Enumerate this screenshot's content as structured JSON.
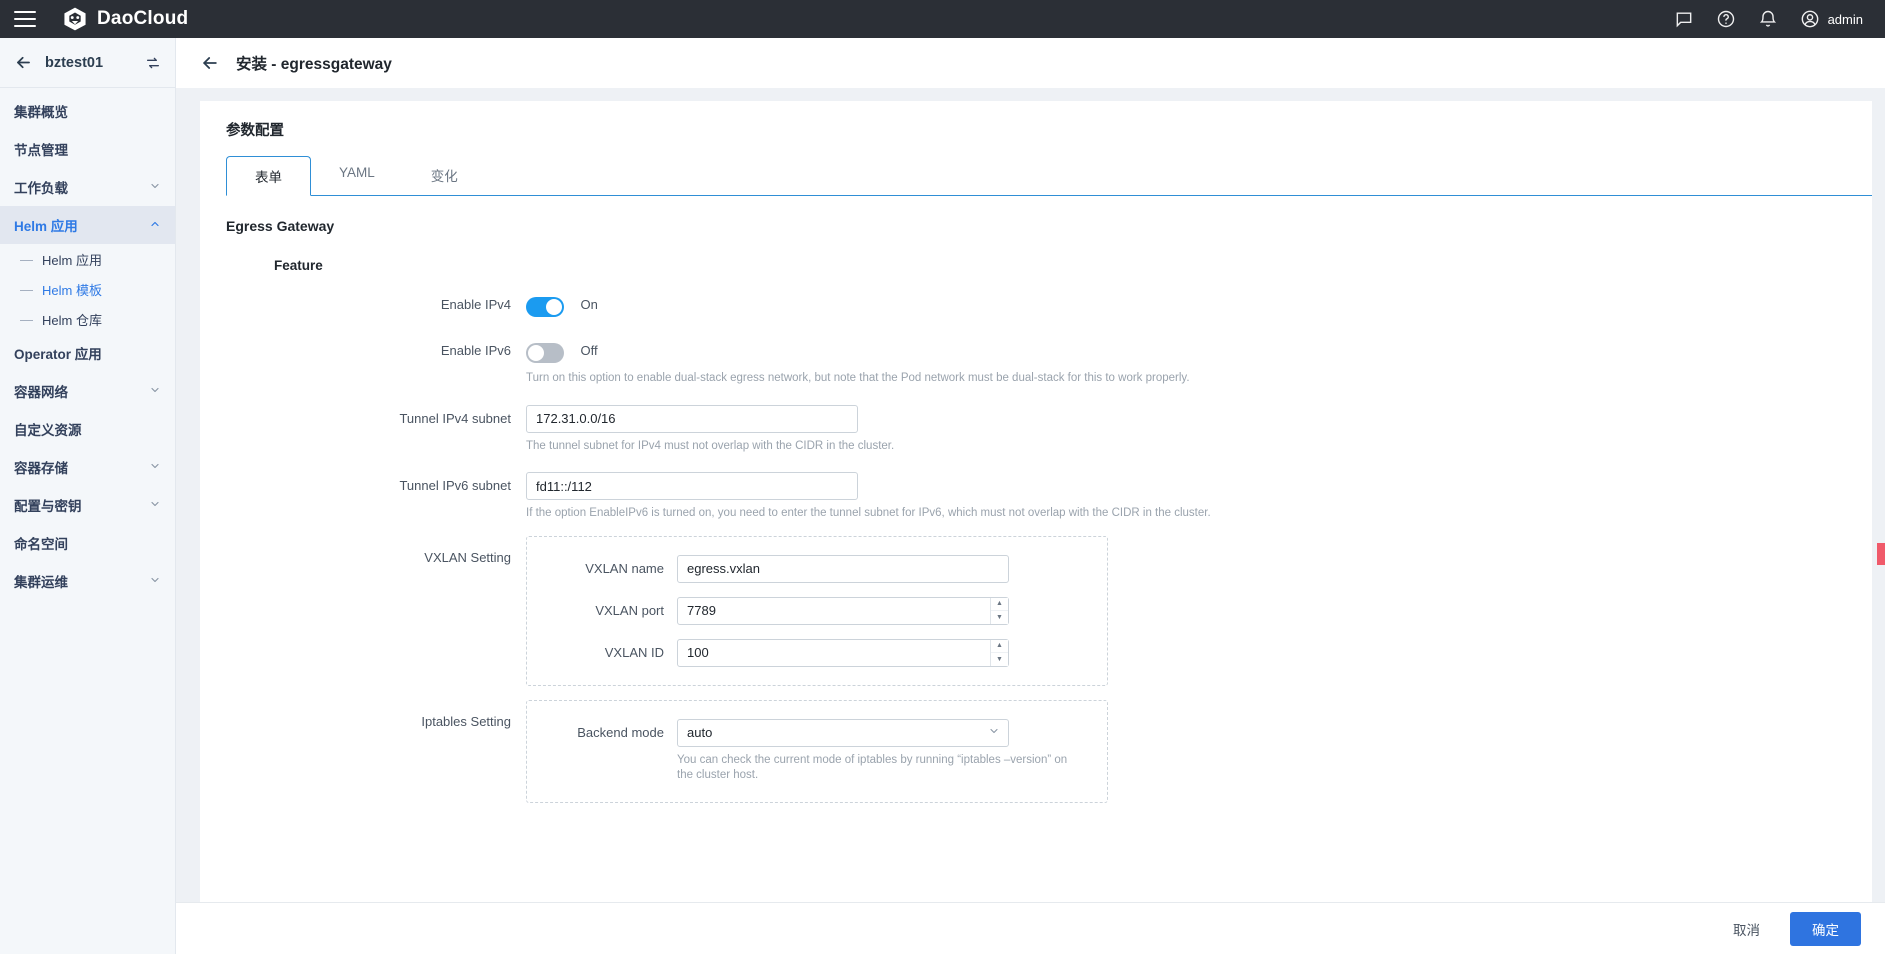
{
  "topbar": {
    "menu_icon": "hamburger-icon",
    "brand": "DaoCloud",
    "icons": [
      "chat-icon",
      "help-icon",
      "bell-icon"
    ],
    "user": "admin"
  },
  "sidebar": {
    "cluster_name": "bztest01",
    "back_icon": "back-arrow-icon",
    "switch_icon": "switch-cluster-icon",
    "items": [
      {
        "label": "集群概览",
        "expandable": false,
        "active": false
      },
      {
        "label": "节点管理",
        "expandable": false,
        "active": false
      },
      {
        "label": "工作负载",
        "expandable": true,
        "active": false
      },
      {
        "label": "Helm 应用",
        "expandable": true,
        "active": true
      },
      {
        "label": "Operator 应用",
        "expandable": false,
        "active": false
      },
      {
        "label": "容器网络",
        "expandable": true,
        "active": false
      },
      {
        "label": "自定义资源",
        "expandable": false,
        "active": false
      },
      {
        "label": "容器存储",
        "expandable": true,
        "active": false
      },
      {
        "label": "配置与密钥",
        "expandable": true,
        "active": false
      },
      {
        "label": "命名空间",
        "expandable": false,
        "active": false
      },
      {
        "label": "集群运维",
        "expandable": true,
        "active": false
      }
    ],
    "sub_items": [
      {
        "label": "Helm 应用",
        "active": false
      },
      {
        "label": "Helm 模板",
        "active": true
      },
      {
        "label": "Helm 仓库",
        "active": false
      }
    ]
  },
  "page": {
    "back_icon": "back-arrow-icon",
    "title": "安装 - egressgateway"
  },
  "card": {
    "title": "参数配置",
    "tabs": [
      {
        "label": "表单",
        "active": true
      },
      {
        "label": "YAML",
        "active": false
      },
      {
        "label": "变化",
        "active": false
      }
    ]
  },
  "form": {
    "section_title": "Egress Gateway",
    "group_title": "Feature",
    "enable_ipv4": {
      "label": "Enable IPv4",
      "state_text": "On",
      "on": true
    },
    "enable_ipv6": {
      "label": "Enable IPv6",
      "state_text": "Off",
      "on": false,
      "helper": "Turn on this option to enable dual-stack egress network, but note that the Pod network must be dual-stack for this to work properly."
    },
    "tunnel_ipv4": {
      "label": "Tunnel IPv4 subnet",
      "value": "172.31.0.0/16",
      "helper": "The tunnel subnet for IPv4 must not overlap with the CIDR in the cluster."
    },
    "tunnel_ipv6": {
      "label": "Tunnel IPv6 subnet",
      "value": "fd11::/112",
      "helper": "If the option EnableIPv6 is turned on, you need to enter the tunnel subnet for IPv6, which must not overlap with the CIDR in the cluster."
    },
    "vxlan": {
      "label": "VXLAN Setting",
      "name": {
        "label": "VXLAN name",
        "value": "egress.vxlan"
      },
      "port": {
        "label": "VXLAN port",
        "value": "7789"
      },
      "id": {
        "label": "VXLAN ID",
        "value": "100"
      }
    },
    "iptables": {
      "label": "Iptables Setting",
      "backend_mode": {
        "label": "Backend mode",
        "value": "auto",
        "helper": "You can check the current mode of iptables by running “iptables –version” on the cluster host."
      }
    }
  },
  "footer": {
    "cancel": "取消",
    "confirm": "确定"
  },
  "colors": {
    "accent": "#2f74e0",
    "toggle_on": "#1b9bf0",
    "topbar_bg": "#2b2f36",
    "sidebar_bg": "#f4f7fa",
    "active_nav": "#2f7ae5"
  }
}
